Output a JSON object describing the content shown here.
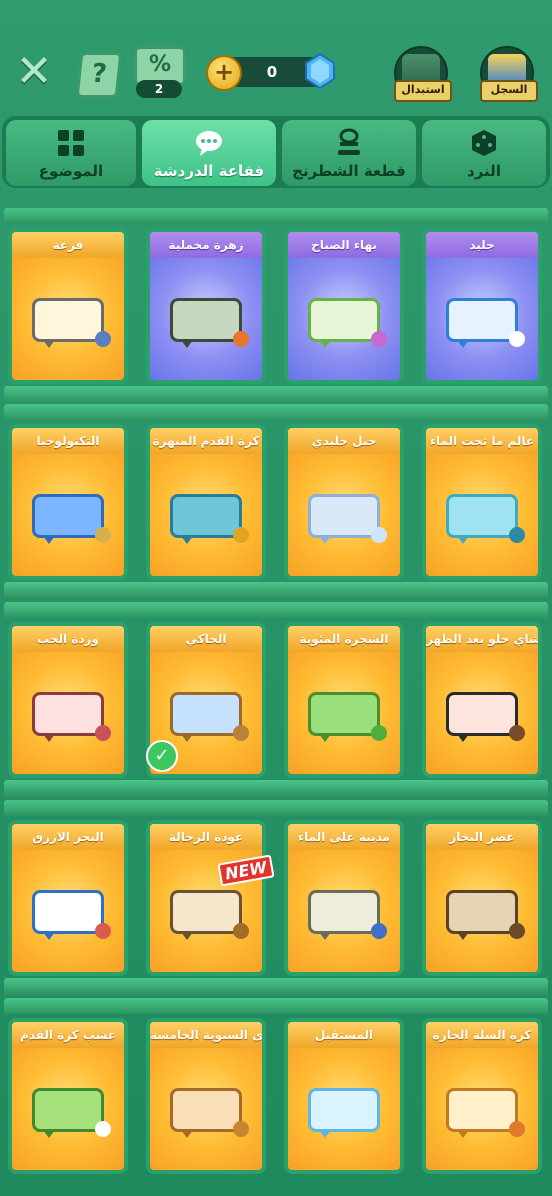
{
  "topbar": {
    "discount_count": "2",
    "gem_count": "0",
    "help_symbol": "?",
    "discount_symbol": "%",
    "plus_symbol": "+",
    "close_symbol": "✕",
    "exchange_label": "استبدال",
    "record_label": "السجل"
  },
  "tabs": [
    {
      "label": "الموضوع",
      "icon": "grid-icon"
    },
    {
      "label": "فقاعة الدردشة",
      "icon": "chat-icon",
      "active": true
    },
    {
      "label": "قطعة الشطرنج",
      "icon": "chess-piece-icon"
    },
    {
      "label": "النرد",
      "icon": "dice-icon"
    }
  ],
  "cards": [
    [
      "فزعة",
      "زهرة مخملية",
      "بهاء الصباح",
      "جليد"
    ],
    [
      "التكنولوجيا",
      "كرة القدم المبهرة",
      "جبل جليدي",
      "عالم ما تحت الماء"
    ],
    [
      "وردة الحب",
      "الحاكي",
      "الشجرة المئوية",
      "شاي حلو بعد الظهر"
    ],
    [
      "البحر الازرق",
      "عودة الرحالة",
      "مدينة على الماء",
      "عصر البخار"
    ],
    [
      "عشب كرة القدم",
      "الذكرى السنوية الخامسة",
      "المستقبل",
      "كرة السلة الحارة"
    ]
  ],
  "badges": {
    "new_label": "NEW",
    "selected_symbol": "✓"
  },
  "colors": {
    "bg": "#2f9b6e",
    "tab_active": "#5dd39a",
    "card_orange": "#ffbb33",
    "card_purple": "#8e90f3"
  }
}
